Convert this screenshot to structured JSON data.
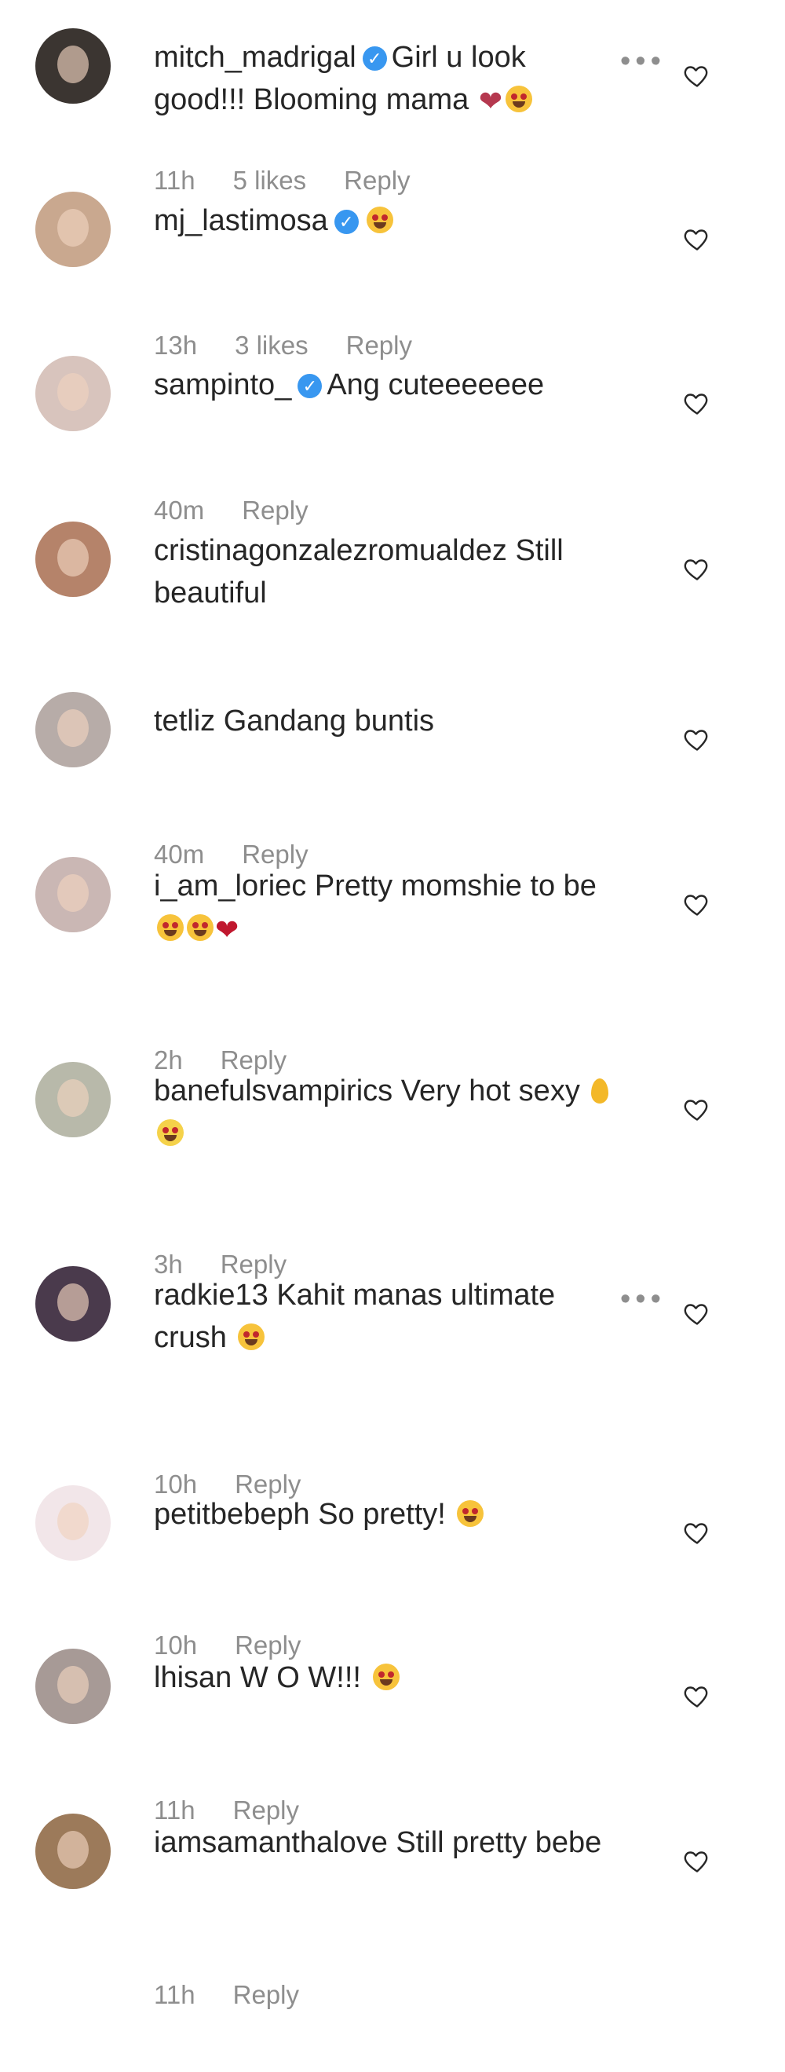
{
  "comments": [
    {
      "user": "mitch_madrigal",
      "verified": true,
      "text": "Girl u look good!!! Blooming mama",
      "emoji": [
        "broken-heart",
        "smile-emoji"
      ],
      "time": "11h",
      "likes": "5 likes",
      "reply": "Reply",
      "more": true
    },
    {
      "user": "mj_lastimosa",
      "verified": true,
      "text": "",
      "emoji": [
        "smile-emoji"
      ],
      "time": "13h",
      "likes": "3 likes",
      "reply": "Reply",
      "more": false
    },
    {
      "user": "sampinto_",
      "verified": true,
      "text": "Ang cuteeeeeee",
      "emoji": [],
      "time": "40m",
      "likes": "",
      "reply": "Reply",
      "more": false
    },
    {
      "user": "cristinagonzalezromualdez",
      "verified": false,
      "text": "Still beautiful",
      "emoji": [],
      "time": "",
      "likes": "",
      "reply": "",
      "more": false
    },
    {
      "user": "tetliz",
      "verified": false,
      "text": "Gandang buntis",
      "emoji": [],
      "time": "40m",
      "likes": "",
      "reply": "Reply",
      "more": false
    },
    {
      "user": "i_am_loriec",
      "verified": false,
      "text": "Pretty momshie to be",
      "emoji": [
        "smile-emoji",
        "smile-emoji",
        "red-heart"
      ],
      "time": "2h",
      "likes": "",
      "reply": "Reply",
      "more": false
    },
    {
      "user": "banefulsvampirics",
      "verified": false,
      "text": "Very hot sexy",
      "emoji": [
        "droplet",
        "sweat-emoji"
      ],
      "time": "3h",
      "likes": "",
      "reply": "Reply",
      "more": false
    },
    {
      "user": "radkie13",
      "verified": false,
      "text": "Kahit manas ultimate crush",
      "emoji": [
        "smile-emoji"
      ],
      "time": "10h",
      "likes": "",
      "reply": "Reply",
      "more": true
    },
    {
      "user": "petitbebeph",
      "verified": false,
      "text": "So pretty!",
      "emoji": [
        "smile-emoji"
      ],
      "time": "10h",
      "likes": "",
      "reply": "Reply",
      "more": false
    },
    {
      "user": "lhisan",
      "verified": false,
      "text": "W O W!!!",
      "emoji": [
        "smile-emoji"
      ],
      "time": "11h",
      "likes": "",
      "reply": "Reply",
      "more": false
    },
    {
      "user": "iamsamanthalove",
      "verified": false,
      "text": "Still pretty bebe",
      "emoji": [],
      "time": "11h",
      "likes": "",
      "reply": "Reply",
      "more": false
    }
  ],
  "icons": {
    "more": "more-options-icon",
    "like": "heart-outline-icon",
    "verified": "verified-badge-icon"
  },
  "colors": {
    "verified": "#3897f0",
    "meta": "#8e8e8e",
    "text": "#262626"
  }
}
